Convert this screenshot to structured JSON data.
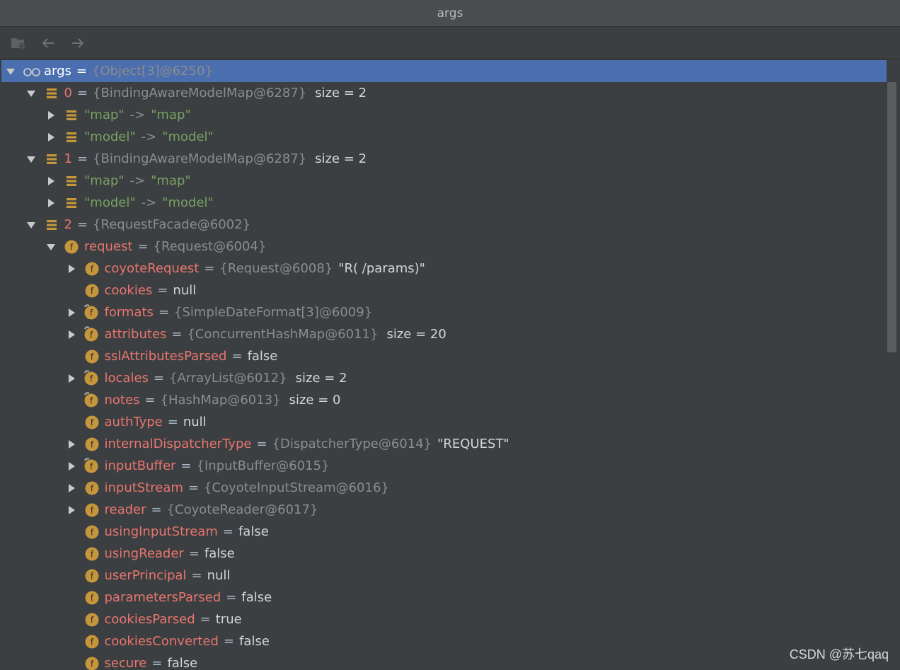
{
  "window": {
    "title": "args"
  },
  "toolbar": {
    "icons": [
      "folder-settings-icon",
      "back-arrow-icon",
      "forward-arrow-icon"
    ]
  },
  "colors": {
    "background": "#3c3f41",
    "selection": "#4b6eaf",
    "field_name": "#e8756f",
    "reference": "#8c8c8c",
    "string": "#77a162",
    "field_icon": "#c6963c"
  },
  "tree": [
    {
      "level": 0,
      "arrow": "expanded",
      "icon": "glasses",
      "selected": true,
      "name": "args",
      "name_style": "root",
      "ref": "{Object[3]@6250}"
    },
    {
      "level": 1,
      "arrow": "expanded",
      "icon": "array",
      "name": "0",
      "name_style": "idx",
      "ref": "{BindingAwareModelMap@6287}",
      "extra": "size = 2"
    },
    {
      "level": 2,
      "arrow": "collapsed",
      "icon": "array",
      "key": "\"map\"",
      "value": "\"map\""
    },
    {
      "level": 2,
      "arrow": "collapsed",
      "icon": "array",
      "key": "\"model\"",
      "value": "\"model\""
    },
    {
      "level": 1,
      "arrow": "expanded",
      "icon": "array",
      "name": "1",
      "name_style": "idx",
      "ref": "{BindingAwareModelMap@6287}",
      "extra": "size = 2"
    },
    {
      "level": 2,
      "arrow": "collapsed",
      "icon": "array",
      "key": "\"map\"",
      "value": "\"map\""
    },
    {
      "level": 2,
      "arrow": "collapsed",
      "icon": "array",
      "key": "\"model\"",
      "value": "\"model\""
    },
    {
      "level": 1,
      "arrow": "expanded",
      "icon": "array",
      "name": "2",
      "name_style": "idx",
      "ref": "{RequestFacade@6002}"
    },
    {
      "level": 2,
      "arrow": "expanded",
      "icon": "field",
      "name": "request",
      "ref": "{Request@6004}"
    },
    {
      "level": 3,
      "arrow": "collapsed",
      "icon": "field",
      "name": "coyoteRequest",
      "ref": "{Request@6008}",
      "value": "\"R( /params)\""
    },
    {
      "level": 3,
      "arrow": "none",
      "icon": "field",
      "name": "cookies",
      "value": "null"
    },
    {
      "level": 3,
      "arrow": "collapsed",
      "icon": "field-final",
      "name": "formats",
      "ref": "{SimpleDateFormat[3]@6009}"
    },
    {
      "level": 3,
      "arrow": "collapsed",
      "icon": "field-final",
      "name": "attributes",
      "ref": "{ConcurrentHashMap@6011}",
      "extra": "size = 20"
    },
    {
      "level": 3,
      "arrow": "none",
      "icon": "field",
      "name": "sslAttributesParsed",
      "value": "false"
    },
    {
      "level": 3,
      "arrow": "collapsed",
      "icon": "field-final",
      "name": "locales",
      "ref": "{ArrayList@6012}",
      "extra": "size = 2"
    },
    {
      "level": 3,
      "arrow": "none",
      "icon": "field-final",
      "name": "notes",
      "ref": "{HashMap@6013}",
      "extra": "size = 0"
    },
    {
      "level": 3,
      "arrow": "none",
      "icon": "field",
      "name": "authType",
      "value": "null"
    },
    {
      "level": 3,
      "arrow": "collapsed",
      "icon": "field",
      "name": "internalDispatcherType",
      "ref": "{DispatcherType@6014}",
      "value": "\"REQUEST\""
    },
    {
      "level": 3,
      "arrow": "collapsed",
      "icon": "field-final",
      "name": "inputBuffer",
      "ref": "{InputBuffer@6015}"
    },
    {
      "level": 3,
      "arrow": "collapsed",
      "icon": "field",
      "name": "inputStream",
      "ref": "{CoyoteInputStream@6016}"
    },
    {
      "level": 3,
      "arrow": "collapsed",
      "icon": "field",
      "name": "reader",
      "ref": "{CoyoteReader@6017}"
    },
    {
      "level": 3,
      "arrow": "none",
      "icon": "field",
      "name": "usingInputStream",
      "value": "false"
    },
    {
      "level": 3,
      "arrow": "none",
      "icon": "field",
      "name": "usingReader",
      "value": "false"
    },
    {
      "level": 3,
      "arrow": "none",
      "icon": "field",
      "name": "userPrincipal",
      "value": "null"
    },
    {
      "level": 3,
      "arrow": "none",
      "icon": "field",
      "name": "parametersParsed",
      "value": "false"
    },
    {
      "level": 3,
      "arrow": "none",
      "icon": "field",
      "name": "cookiesParsed",
      "value": "true"
    },
    {
      "level": 3,
      "arrow": "none",
      "icon": "field",
      "name": "cookiesConverted",
      "value": "false"
    },
    {
      "level": 3,
      "arrow": "none",
      "icon": "field",
      "name": "secure",
      "value": "false"
    }
  ],
  "watermark": "CSDN @苏七qaq"
}
